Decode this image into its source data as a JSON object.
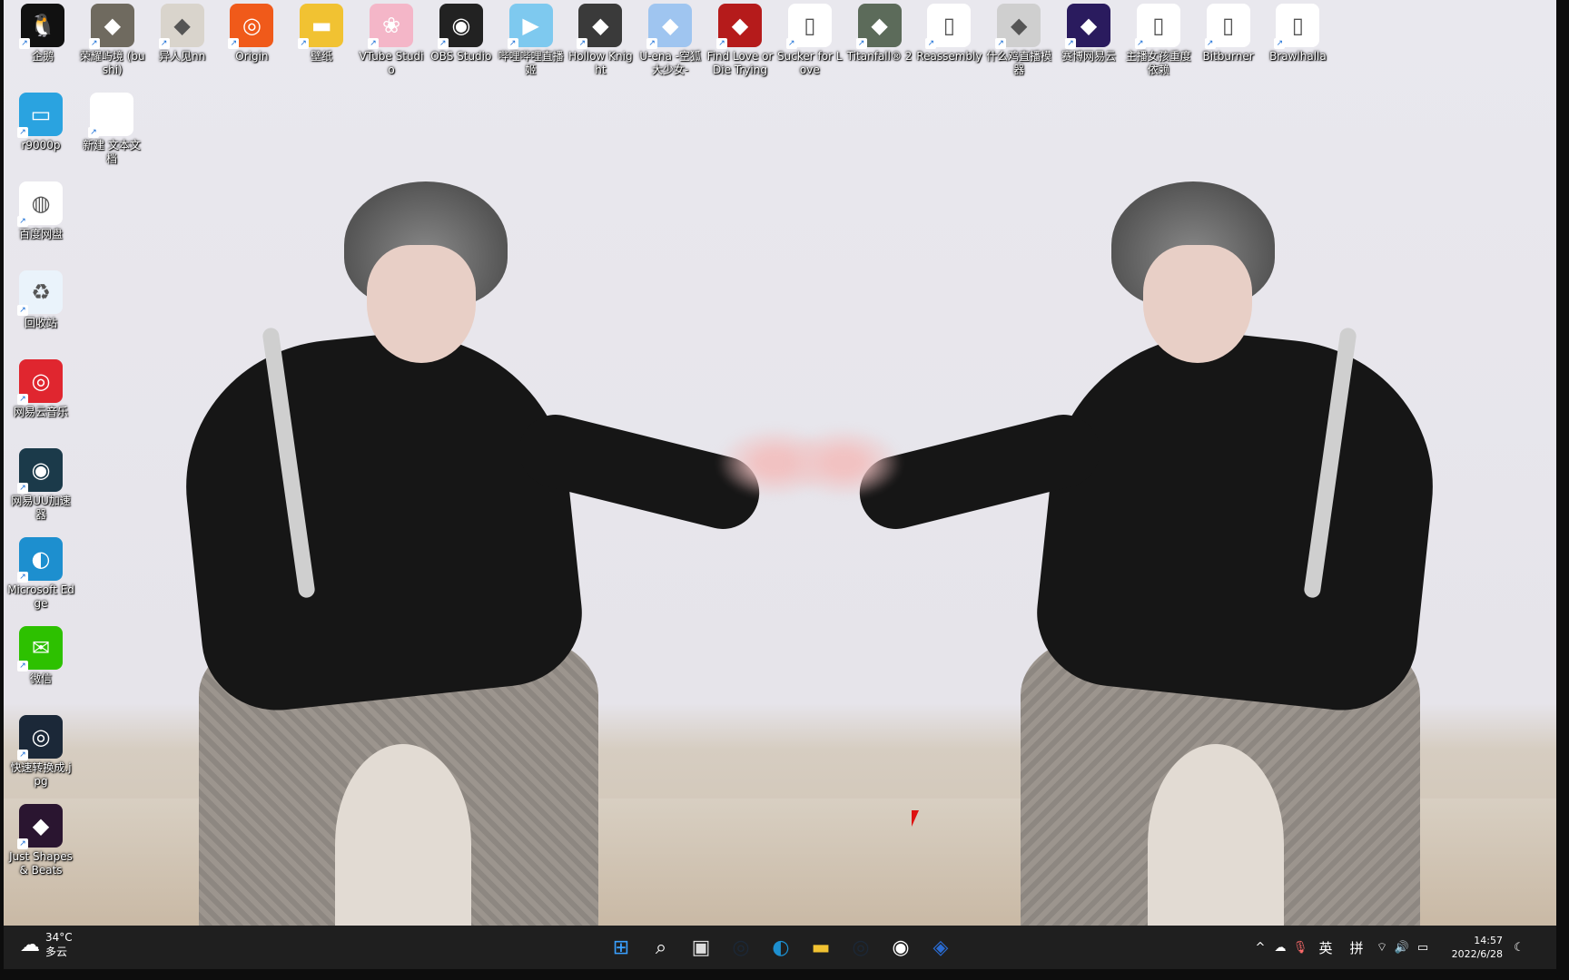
{
  "desktop": {
    "icons_top": [
      {
        "label": "企鹅",
        "icon": "qq-icon",
        "color": "#111111"
      },
      {
        "label": "荣耀屿境 (bushi)",
        "icon": "game-icon",
        "color": "#6f6a5f"
      },
      {
        "label": "异人见nn",
        "icon": "game-icon",
        "color": "#d9d4cc"
      },
      {
        "label": "Origin",
        "icon": "origin-icon",
        "color": "#f05a1a"
      },
      {
        "label": "壁纸",
        "icon": "folder-icon",
        "color": "#f1c232"
      },
      {
        "label": "VTube Studio",
        "icon": "vtube-icon",
        "color": "#f4b6c8"
      },
      {
        "label": "OBS Studio",
        "icon": "obs-icon",
        "color": "#222222"
      },
      {
        "label": "哔哩哔哩直播姬",
        "icon": "bilibili-live-icon",
        "color": "#7ec9ef"
      },
      {
        "label": "Hollow Knight",
        "icon": "game-icon",
        "color": "#3a3a3a"
      },
      {
        "label": "U-ena -空狐大少女-",
        "icon": "game-icon",
        "color": "#9fc5f0"
      },
      {
        "label": "Find Love or Die Trying",
        "icon": "game-icon",
        "color": "#b51b1b"
      },
      {
        "label": "Sucker for Love",
        "icon": "file-icon",
        "color": "#ffffff"
      },
      {
        "label": "Titanfall® 2",
        "icon": "game-icon",
        "color": "#5c6b5a"
      },
      {
        "label": "Reassembly",
        "icon": "file-icon",
        "color": "#ffffff"
      },
      {
        "label": "什么鸡直播模器",
        "icon": "game-icon",
        "color": "#cfcfcf"
      },
      {
        "label": "赛博网易云",
        "icon": "game-icon",
        "color": "#2a1b5e"
      },
      {
        "label": "主播女孩重度依赖",
        "icon": "file-icon",
        "color": "#ffffff"
      },
      {
        "label": "Bitburner",
        "icon": "file-icon",
        "color": "#ffffff"
      },
      {
        "label": "Brawlhalla",
        "icon": "file-icon",
        "color": "#ffffff"
      }
    ],
    "icons_left": [
      {
        "label": "r9000p",
        "icon": "computer-icon",
        "color": "#2aa3e0"
      },
      {
        "label": "百度网盘",
        "icon": "baidu-netdisk-icon",
        "color": "#ffffff"
      },
      {
        "label": "回收站",
        "icon": "recycle-bin-icon",
        "color": "#eaf3fb"
      },
      {
        "label": "网易云音乐",
        "icon": "netease-music-icon",
        "color": "#e0262f"
      },
      {
        "label": "网易UU加速器",
        "icon": "uu-accelerator-icon",
        "color": "#1b3a4a"
      },
      {
        "label": "Microsoft Edge",
        "icon": "edge-icon",
        "color": "#1d8fcf"
      },
      {
        "label": "微信",
        "icon": "wechat-icon",
        "color": "#2dc100"
      },
      {
        "label": "快速转换成.jpg",
        "icon": "steam-icon",
        "color": "#1b2838"
      },
      {
        "label": "Just Shapes & Beats",
        "icon": "game-icon",
        "color": "#2a1530"
      }
    ],
    "icon_extra": {
      "label": "新建 文本文档",
      "icon": "text-file-icon"
    }
  },
  "taskbar": {
    "weather": {
      "temp": "34°C",
      "desc": "多云",
      "icon": "cloud-sun-icon"
    },
    "apps": [
      {
        "name": "start-button",
        "icon": "windows-icon",
        "color": "#3aa0ff"
      },
      {
        "name": "search-button",
        "icon": "search-icon",
        "color": "#ffffff"
      },
      {
        "name": "task-view-button",
        "icon": "task-view-icon",
        "color": "#dddddd"
      },
      {
        "name": "taskbar-steam-1",
        "icon": "steam-icon",
        "color": "#1b2838"
      },
      {
        "name": "taskbar-edge",
        "icon": "edge-icon",
        "color": "#1d8fcf"
      },
      {
        "name": "taskbar-explorer",
        "icon": "folder-icon",
        "color": "#f1c232"
      },
      {
        "name": "taskbar-steam-2",
        "icon": "steam-icon",
        "color": "#1b2838"
      },
      {
        "name": "taskbar-obs",
        "icon": "obs-icon",
        "color": "#ffffff"
      },
      {
        "name": "taskbar-app",
        "icon": "app-icon",
        "color": "#2a6bd1"
      }
    ],
    "tray": {
      "ime_lang": "英",
      "ime_mode": "拼",
      "time": "14:57",
      "date": "2022/6/28"
    }
  }
}
